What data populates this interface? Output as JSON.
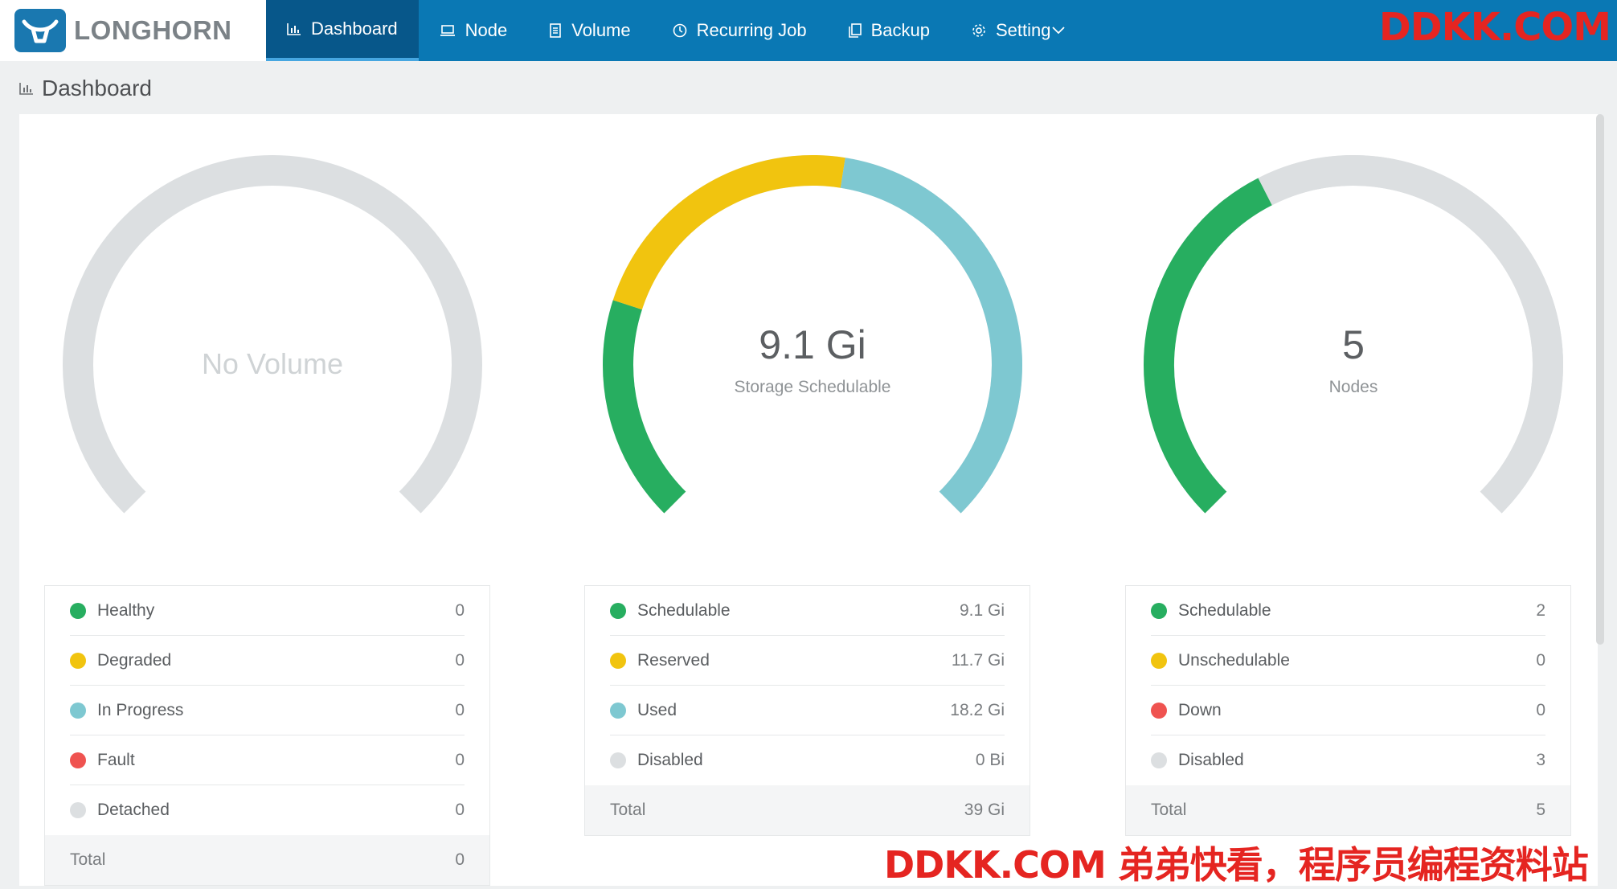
{
  "brand": {
    "name": "LONGHORN"
  },
  "nav": {
    "items": [
      {
        "label": "Dashboard",
        "icon": "bar-chart-icon",
        "active": true
      },
      {
        "label": "Node",
        "icon": "laptop-icon"
      },
      {
        "label": "Volume",
        "icon": "volume-icon"
      },
      {
        "label": "Recurring Job",
        "icon": "clock-icon"
      },
      {
        "label": "Backup",
        "icon": "copy-icon"
      },
      {
        "label": "Setting",
        "icon": "gear-icon",
        "dropdown": true
      }
    ]
  },
  "watermark": {
    "top": "DDKK.COM",
    "bottom": "DDKK.COM 弟弟快看，程序员编程资料站"
  },
  "page": {
    "title": "Dashboard"
  },
  "colors": {
    "healthy": "#27ae60",
    "degraded": "#f1c40f",
    "in_progress": "#7ec8d1",
    "fault": "#ef5350",
    "disabled": "#dcdfe1",
    "track": "#dcdfe1"
  },
  "volume_panel": {
    "empty_text": "No Volume",
    "rows": [
      {
        "label": "Healthy",
        "value": "0",
        "color": "#27ae60"
      },
      {
        "label": "Degraded",
        "value": "0",
        "color": "#f1c40f"
      },
      {
        "label": "In Progress",
        "value": "0",
        "color": "#7ec8d1"
      },
      {
        "label": "Fault",
        "value": "0",
        "color": "#ef5350"
      },
      {
        "label": "Detached",
        "value": "0",
        "color": "#dcdfe1"
      }
    ],
    "total_label": "Total",
    "total_value": "0"
  },
  "storage_panel": {
    "value": "9.1 Gi",
    "label": "Storage Schedulable",
    "rows": [
      {
        "label": "Schedulable",
        "value": "9.1 Gi",
        "color": "#27ae60"
      },
      {
        "label": "Reserved",
        "value": "11.7 Gi",
        "color": "#f1c40f"
      },
      {
        "label": "Used",
        "value": "18.2 Gi",
        "color": "#7ec8d1"
      },
      {
        "label": "Disabled",
        "value": "0 Bi",
        "color": "#dcdfe1"
      }
    ],
    "total_label": "Total",
    "total_value": "39 Gi",
    "segments": [
      {
        "name": "Schedulable",
        "fraction": 0.2333,
        "color": "#27ae60"
      },
      {
        "name": "Reserved",
        "fraction": 0.3,
        "color": "#f1c40f"
      },
      {
        "name": "Used",
        "fraction": 0.4667,
        "color": "#7ec8d1"
      }
    ]
  },
  "node_panel": {
    "value": "5",
    "label": "Nodes",
    "rows": [
      {
        "label": "Schedulable",
        "value": "2",
        "color": "#27ae60"
      },
      {
        "label": "Unschedulable",
        "value": "0",
        "color": "#f1c40f"
      },
      {
        "label": "Down",
        "value": "0",
        "color": "#ef5350"
      },
      {
        "label": "Disabled",
        "value": "3",
        "color": "#dcdfe1"
      }
    ],
    "total_label": "Total",
    "total_value": "5",
    "segments": [
      {
        "name": "Schedulable",
        "fraction": 0.4,
        "color": "#27ae60"
      },
      {
        "name": "Disabled",
        "fraction": 0.6,
        "color": "#dcdfe1"
      }
    ]
  }
}
